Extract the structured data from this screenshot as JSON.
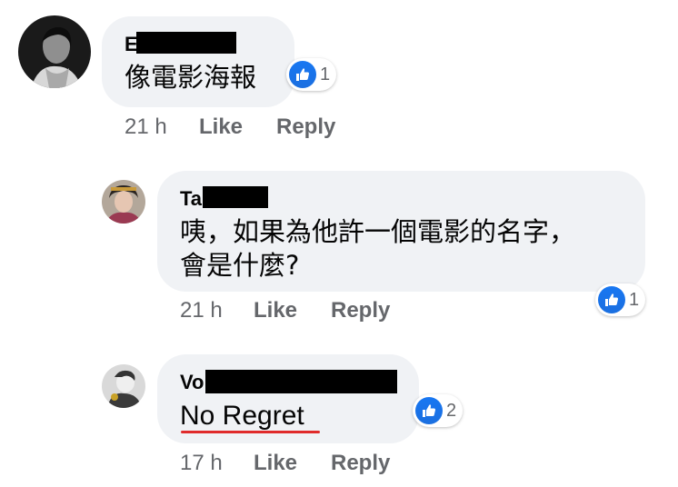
{
  "comments": [
    {
      "name_prefix": "E",
      "text": "像電影海報",
      "reactions": "1",
      "time": "21 h",
      "like": "Like",
      "reply": "Reply"
    },
    {
      "name_prefix": "Ta",
      "text_line1": "咦，如果為他許一個電影的名字，",
      "text_line2": "會是什麼?",
      "reactions": "1",
      "time": "21 h",
      "like": "Like",
      "reply": "Reply"
    },
    {
      "name_prefix": "Vo",
      "text": "No Regret",
      "reactions": "2",
      "time": "17 h",
      "like": "Like",
      "reply": "Reply"
    }
  ],
  "icons": {
    "reaction": "thumbs-up-icon",
    "avatar": "avatar"
  },
  "colors": {
    "like_blue": "#1877f2",
    "bubble": "#f0f2f5",
    "meta": "#65676b",
    "underline": "#e02b2b"
  }
}
